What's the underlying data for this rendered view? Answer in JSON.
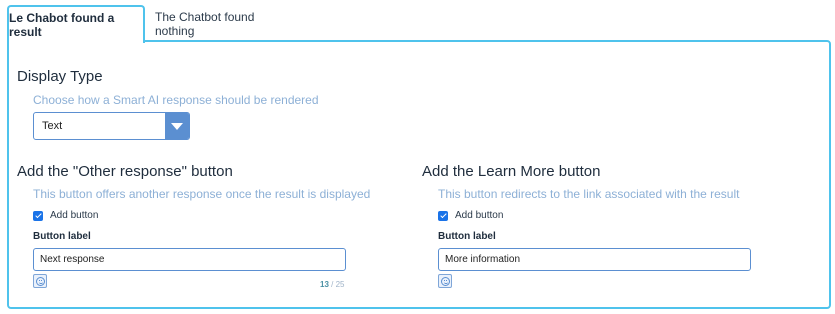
{
  "tabs": {
    "found_label": "Le Chabot found a result",
    "nothing_label": "The Chatbot found nothing"
  },
  "display_type": {
    "title": "Display Type",
    "description": "Choose how a Smart AI response should be rendered",
    "selected": "Text"
  },
  "other_response": {
    "title": "Add the \"Other response\" button",
    "description": "This button offers another response once the result is displayed",
    "checkbox_label": "Add button",
    "field_label": "Button label",
    "value": "Next response",
    "count_current": "13",
    "count_sep": " / ",
    "count_max": "25"
  },
  "learn_more": {
    "title": "Add the Learn More button",
    "description": "This button redirects to the link associated with the result",
    "checkbox_label": "Add button",
    "field_label": "Button label",
    "value": "More information"
  }
}
